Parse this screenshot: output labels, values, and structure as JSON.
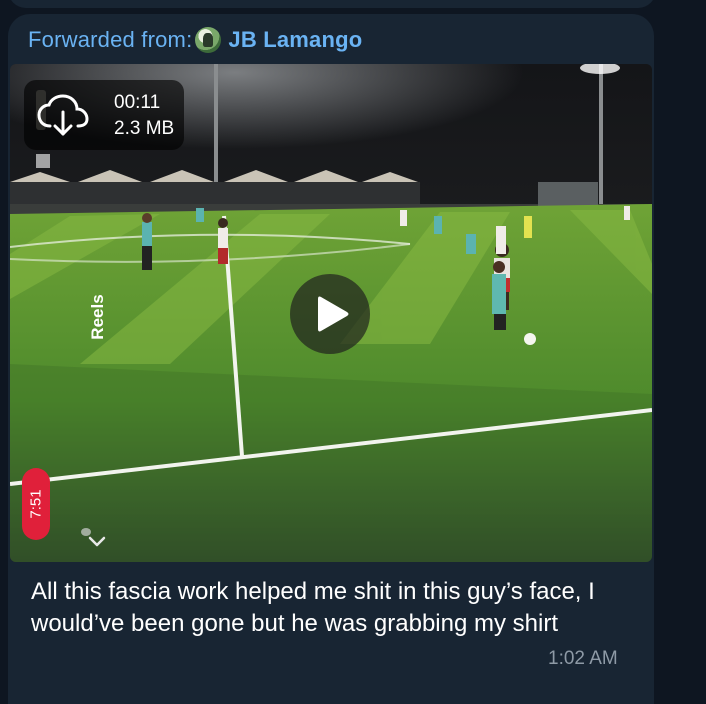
{
  "message": {
    "forwarded_label": "Forwarded from:",
    "forwarded_name": "JB Lamango",
    "video": {
      "duration": "00:11",
      "size": "2.3 MB",
      "reels_label": "Reels",
      "timer_label": "7:51"
    },
    "caption": "All this fascia work helped me shit in this guy’s face, I would’ve been gone but he was grabbing my shirt",
    "time": "1:02 AM"
  },
  "colors": {
    "background": "#0e1621",
    "bubble": "#182533",
    "link": "#6ab3f3",
    "timestamp": "#8e9aa6",
    "timer_pill": "#e0203a"
  },
  "icons": [
    "download-cloud-icon",
    "play-icon",
    "chevron-down-icon",
    "author-avatar"
  ]
}
